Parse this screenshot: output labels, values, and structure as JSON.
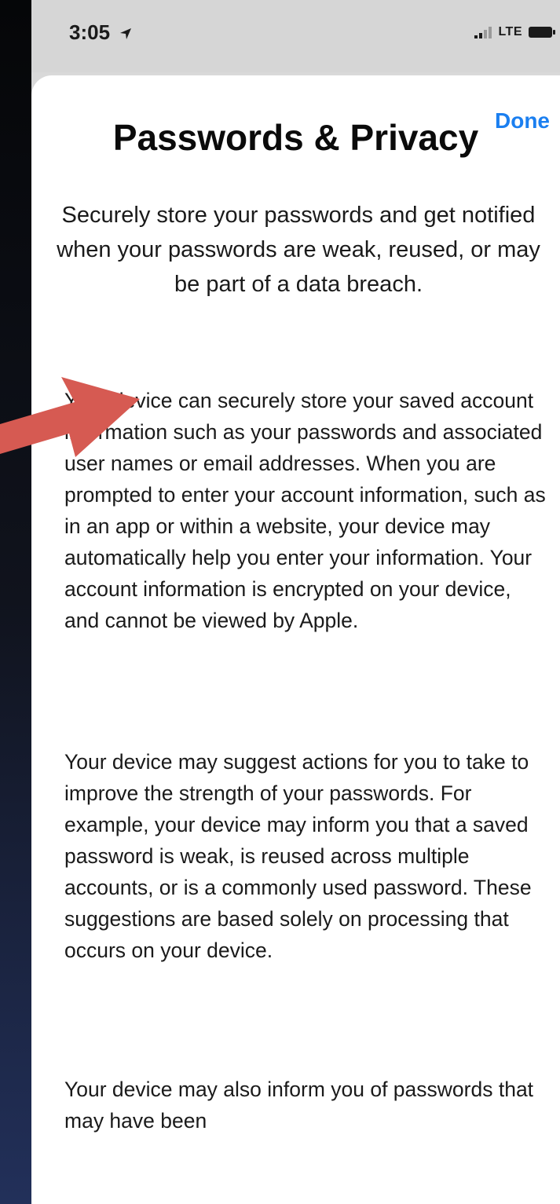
{
  "status_bar": {
    "time": "3:05",
    "network": "LTE"
  },
  "header": {
    "done_label": "Done"
  },
  "content": {
    "title": "Passwords & Privacy",
    "subtitle": "Securely store your passwords and get notified when your passwords are weak, reused, or may be part of a data breach.",
    "paragraphs": [
      "Your device can securely store your saved account information such as your passwords and associated user names or email addresses. When you are prompted to enter your account information, such as in an app or within a website, your device may automatically help you enter your information. Your account information is encrypted on your device, and cannot be viewed by Apple.",
      "Your device may suggest actions for you to take to improve the strength of your passwords. For example, your device may inform you that a saved password is weak, is reused across multiple accounts, or is a commonly used password. These suggestions are based solely on processing that occurs on your device.",
      "Your device may also inform you of passwords that may have been"
    ]
  },
  "colors": {
    "accent": "#1b7ff0",
    "annotation_arrow": "#d65a52"
  },
  "icons": {
    "location": "location-arrow-icon",
    "signal": "cellular-signal-icon",
    "battery": "battery-icon",
    "annotation": "red-arrow-icon"
  }
}
